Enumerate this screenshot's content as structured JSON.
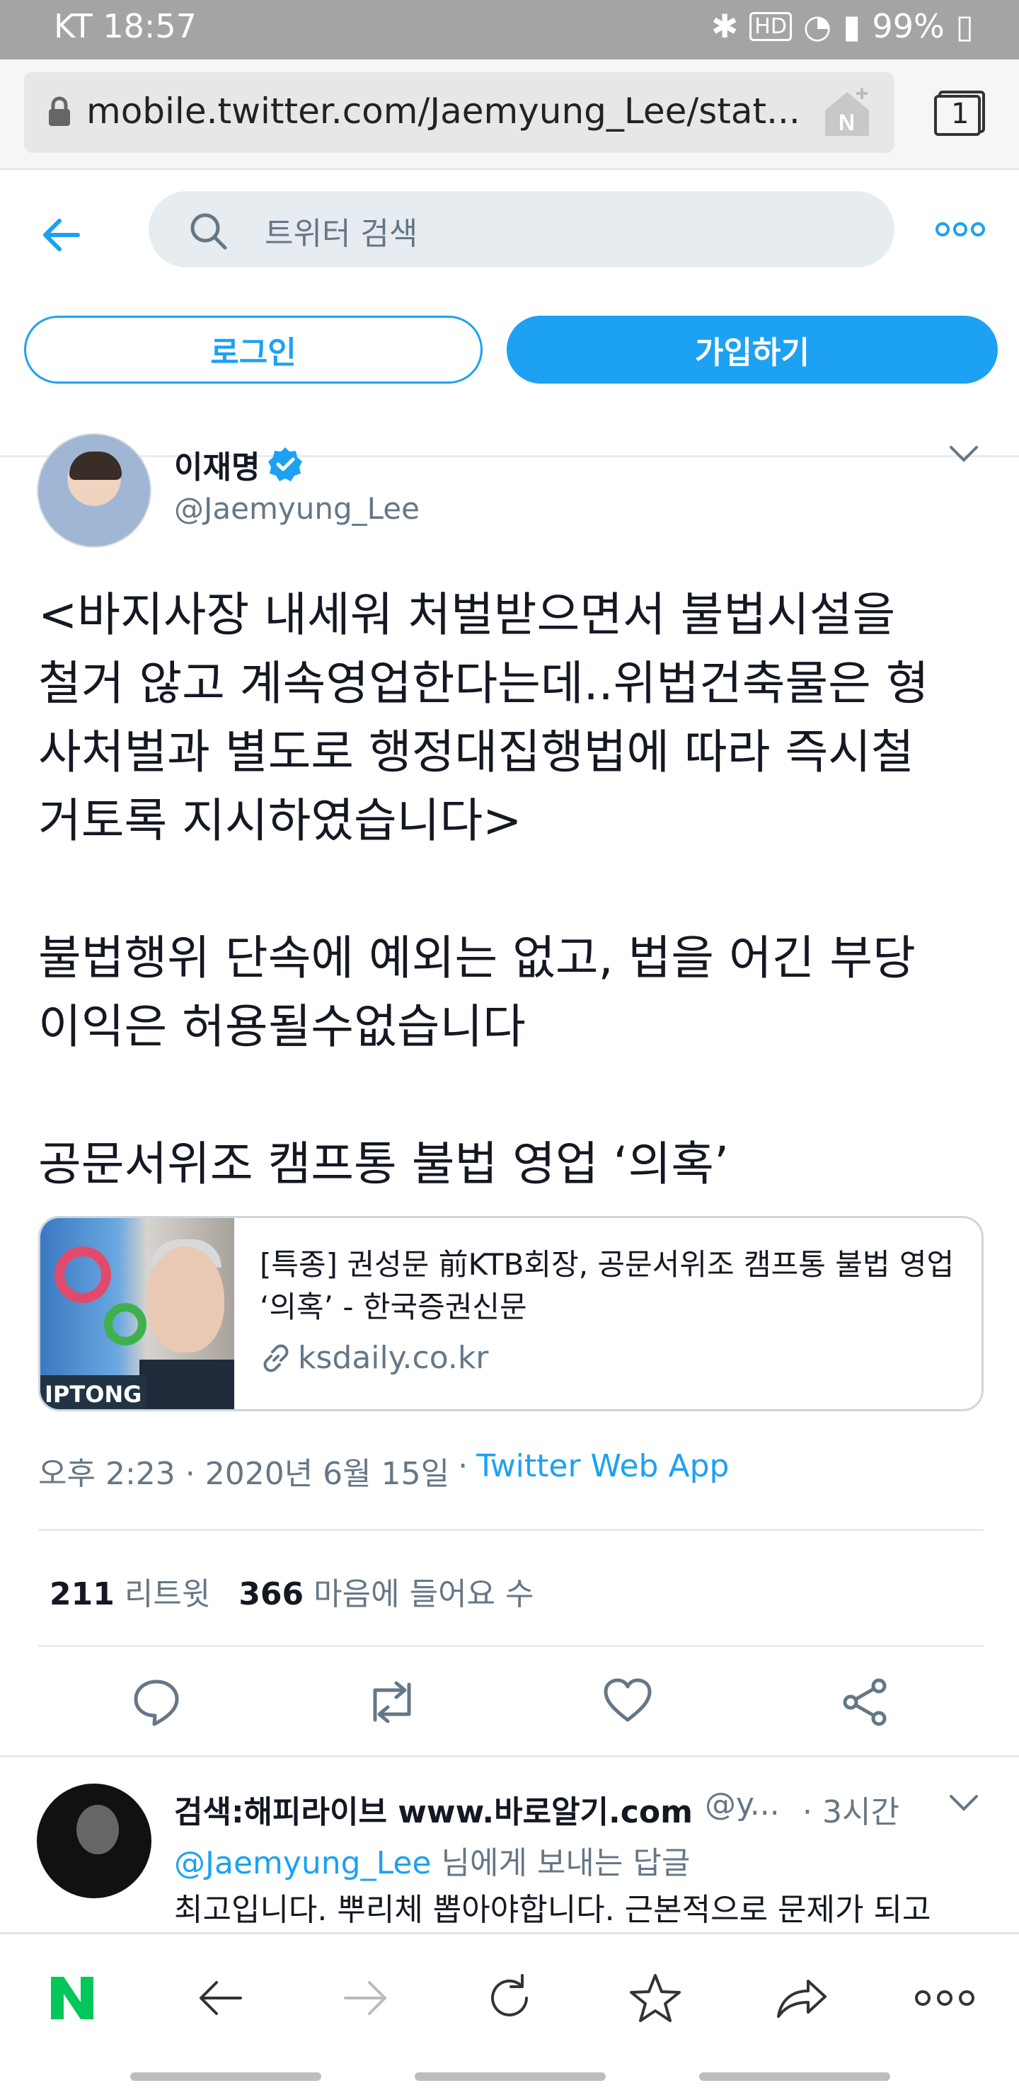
{
  "status_bar": {
    "carrier_time": "KT 18:57",
    "battery": "99%"
  },
  "browser": {
    "url": "mobile.twitter.com/Jaemyung_Lee/stat...",
    "tab_count": "1"
  },
  "twitter": {
    "search_placeholder": "트위터 검색",
    "login_label": "로그인",
    "signup_label": "가입하기"
  },
  "tweet": {
    "author_name": "이재명",
    "author_handle": "@Jaemyung_Lee",
    "text": "<바지사장 내세워 처벌받으면서 불법시설을\n철거 않고 계속영업한다는데..위법건축물은 형\n사처벌과 별도로 행정대집행법에 따라 즉시철\n거토록 지시하였습니다>\n\n불법행위 단속에 예외는 없고, 법을 어긴 부당\n이익은 허용될수없습니다\n\n공문서위조 캠프통 불법 영업 ‘의혹’",
    "card": {
      "title": "[특종] 권성문 前KTB회장, 공문서위조 캠프통 불법 영업 ‘의혹’ - 한국증권신문",
      "domain": "ksdaily.co.kr",
      "thumb_brand": "IPTONG"
    },
    "time": "오후 2:23 · 2020년 6월 15일",
    "separator": "·",
    "app": "Twitter Web App",
    "retweets_count": "211",
    "retweets_label": "리트윗",
    "likes_count": "366",
    "likes_label": "마음에 들어요 수"
  },
  "reply": {
    "name": "검색:해피라이브 www.바로알기.com",
    "handle": "@y...",
    "time": "· 3시간",
    "to_handle": "@Jaemyung_Lee",
    "to_suffix": " 님에게 보내는 답글",
    "text": "최고입니다. 뿌리체 뽑아야합니다. 근본적으로 문제가 되고"
  },
  "colors": {
    "twitter_blue": "#1da1f2",
    "gray_text": "#657786",
    "naver_green": "#03c75a"
  }
}
